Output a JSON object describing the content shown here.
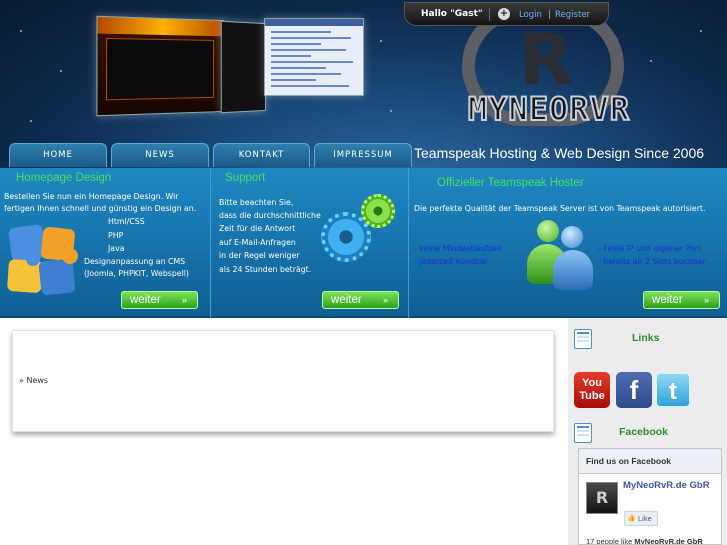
{
  "topbar": {
    "greeting": "Hallo \"Gast\"",
    "plus": "+",
    "login": "Login",
    "separator": "|",
    "register": "Register"
  },
  "logo": {
    "letter": "R",
    "wordmark": "MYNEORVR"
  },
  "nav": {
    "items": [
      "HOME",
      "NEWS",
      "KONTAKT",
      "IMPRESSUM"
    ],
    "slogan": "Teamspeak Hosting & Web Design Since 2006"
  },
  "features": {
    "homepage": {
      "title": "Homepage Design",
      "intro1": "Bestellen Sie nun ein Homepage Design. Wir",
      "intro2": "fertigen Ihnen schnell und günstig ein Design an.",
      "list": [
        "Html/CSS",
        "PHP",
        "Java",
        "Designanpassung an CMS",
        "(Joomla, PHPKIT, Webspell)"
      ],
      "button": "weiter"
    },
    "support": {
      "title": "Support",
      "lines": [
        "Bitte beachten Sie,",
        "dass die durchschnittliche",
        "Zeit für die Antwort",
        "auf E-Mail-Anfragen",
        "in der Regel weniger",
        "als 24 Stunden beträgt."
      ],
      "button": "weiter"
    },
    "teamspeak": {
      "title": "Offizieller Teamspeak Hoster",
      "intro": "Die perfekte Qualität der Teamspeak Server ist von Teamspeak autorisiert.",
      "left": [
        "- keine Mindestlaufzeit",
        "- jederzeit kündbar"
      ],
      "right": [
        "- Feste IP und eigener Port",
        "- bereits ab 2 Slots buchbar"
      ],
      "button": "weiter"
    },
    "arrow": "»"
  },
  "main": {
    "breadcrumb": "» News"
  },
  "sidebar": {
    "links_title": "Links",
    "social": {
      "youtube": "You Tube",
      "facebook": "f",
      "twitter": "t"
    },
    "facebook_title": "Facebook",
    "fb_widget": {
      "header": "Find us on Facebook",
      "page_name": "MyNeoRvR.de GbR",
      "avatar_letter": "R",
      "like": "Like",
      "count_text": "17 people like",
      "count_page": "MyNeoRvR.de GbR"
    }
  },
  "colors": {
    "accent_green": "#43e05a",
    "band_blue": "#1f88c2",
    "header_navy": "#0e2c4f",
    "link_blue": "#1e2fd6",
    "fb_blue": "#3b5998"
  }
}
